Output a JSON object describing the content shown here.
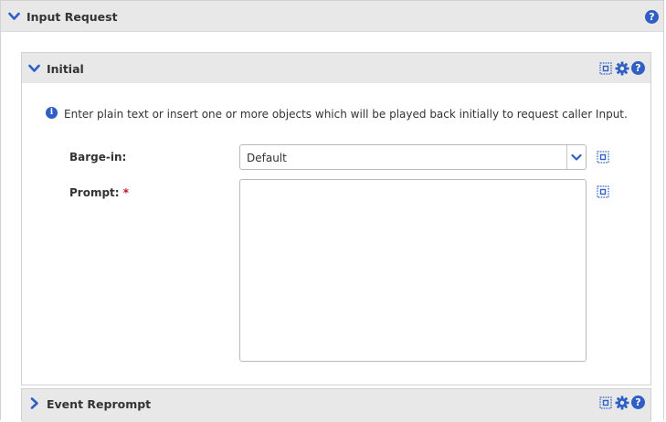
{
  "input_request": {
    "title": "Input Request"
  },
  "initial": {
    "title": "Initial",
    "info": "Enter plain text or insert one or more objects which will be played back initially to request caller Input.",
    "barge_in": {
      "label": "Barge-in:",
      "value": "Default"
    },
    "prompt": {
      "label": "Prompt:",
      "required_marker": "*",
      "value": ""
    }
  },
  "event_reprompt": {
    "title": "Event Reprompt"
  },
  "icons": {
    "expanded": "chevron-down-icon",
    "collapsed": "chevron-right-icon",
    "help": "help-icon",
    "settings": "gear-icon",
    "variable": "variable-insert-icon",
    "info": "info-icon",
    "dropdown": "chevron-down-icon"
  },
  "colors": {
    "accent": "#2f5fc4",
    "header_bg": "#e8e8e8",
    "required": "#c8102e"
  }
}
